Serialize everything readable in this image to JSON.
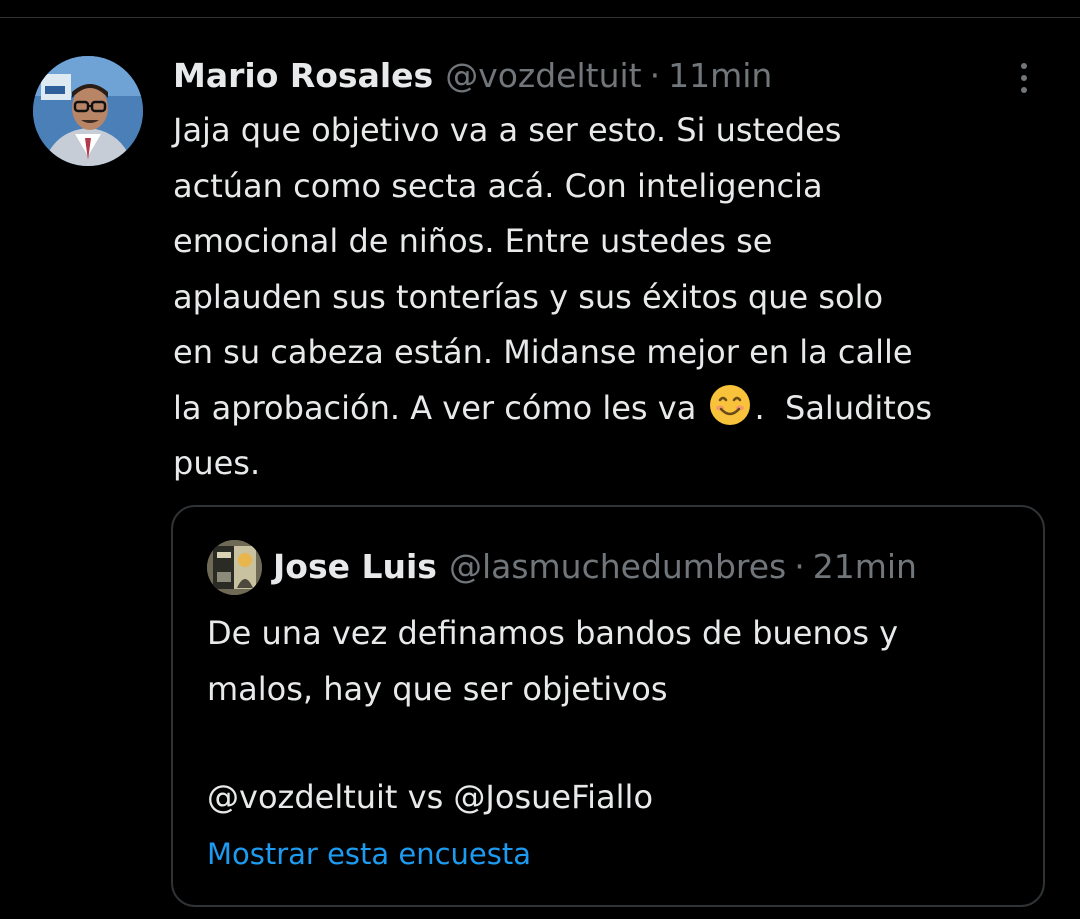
{
  "tweet": {
    "author_name": "Mario Rosales",
    "author_handle": "@vozdeltuit",
    "separator": "·",
    "time": "11min",
    "body_line_1": "Jaja que objetivo va a ser esto. Si ustedes",
    "body_line_2": "actúan como secta acá. Con inteligencia",
    "body_line_3": "emocional de niños. Entre ustedes se",
    "body_line_4": "aplauden sus tonterías y sus éxitos que solo",
    "body_line_5": "en su cabeza están. Midanse mejor en la calle",
    "body_line_6_before_emoji": "la aprobación. A ver cómo les va ",
    "body_line_6_after_emoji": ".  Saluditos",
    "body_line_7": "pues.",
    "emoji_icon": "smiling-face-emoji",
    "more_icon": "more-vertical-icon"
  },
  "quoted_tweet": {
    "author_name": "Jose Luis",
    "author_handle": "@lasmuchedumbres",
    "separator": "·",
    "time": "21min",
    "text_line_1": "De una vez definamos bandos de buenos y",
    "text_line_2": "malos, hay que ser objetivos",
    "mentions": "@vozdeltuit vs @JosueFiallo",
    "poll_link": "Mostrar esta encuesta"
  },
  "colors": {
    "background": "#000000",
    "primary_text": "#e7e9ea",
    "secondary_text": "#71767b",
    "border": "#2f3336",
    "link": "#1d9bf0"
  }
}
